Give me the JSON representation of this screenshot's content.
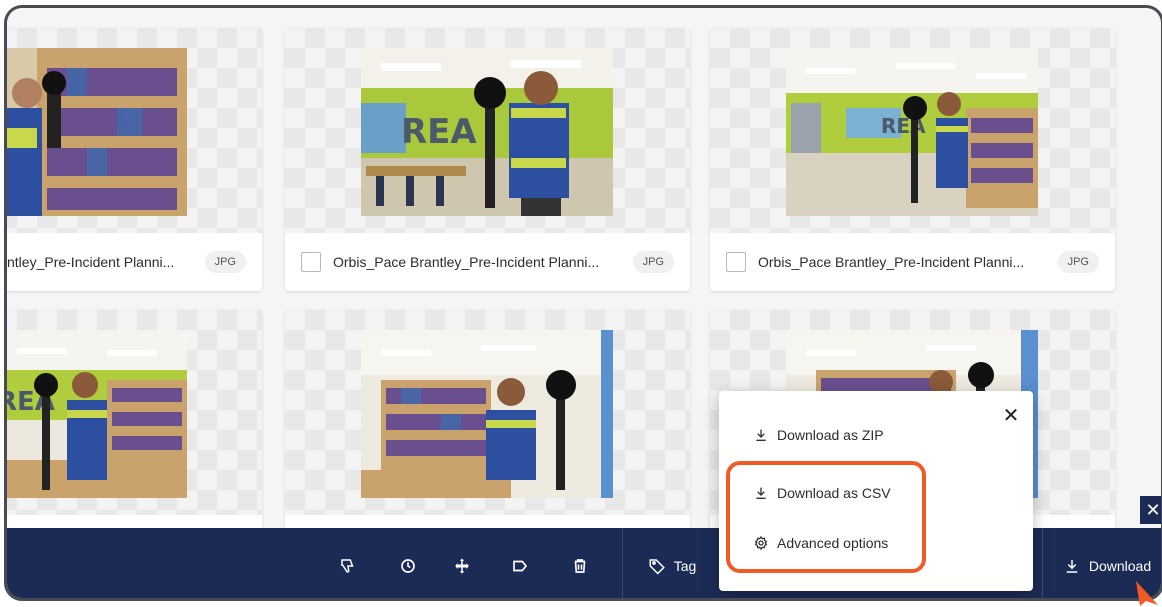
{
  "cards": [
    {
      "name": "ntley_Pre-Incident Planni...",
      "type": "JPG",
      "checkbox": false
    },
    {
      "name": "Orbis_Pace Brantley_Pre-Incident Planni...",
      "type": "JPG",
      "checkbox": true
    },
    {
      "name": "Orbis_Pace Brantley_Pre-Incident Planni...",
      "type": "JPG",
      "checkbox": true
    }
  ],
  "toolbar": {
    "icons": [
      "thumbs-down-icon",
      "clock-icon",
      "move-icon",
      "label-icon",
      "trash-icon"
    ],
    "tag_label": "Tag",
    "download_label": "Download"
  },
  "download_menu": {
    "zip_label": "Download as ZIP",
    "csv_label": "Download as CSV",
    "advanced_label": "Advanced options",
    "close_symbol": "✕"
  },
  "side_close_symbol": "✕",
  "colors": {
    "toolbar_bg": "#1c2b55",
    "highlight": "#f15a24",
    "frame_border": "#4a4a55"
  }
}
